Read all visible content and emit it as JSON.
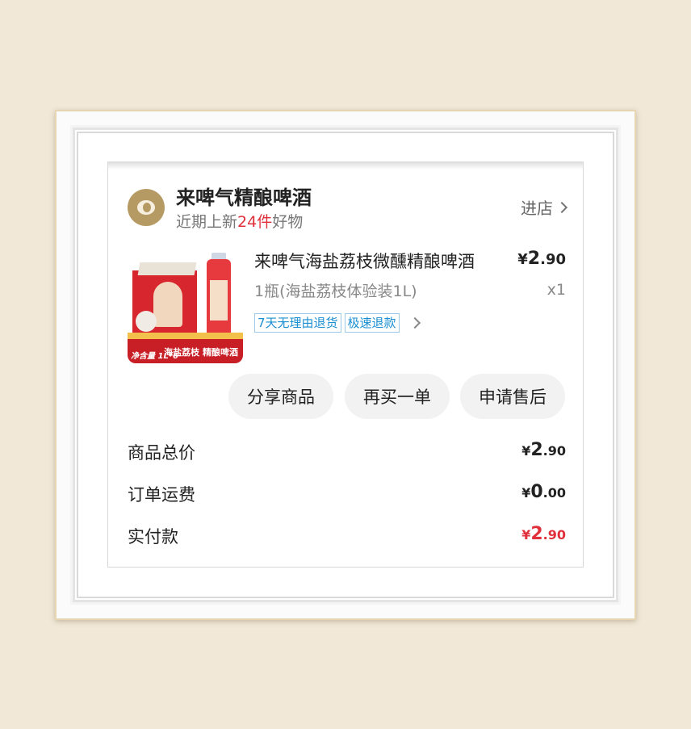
{
  "store": {
    "name": "来啤气精酿啤酒",
    "sub_prefix": "近期上新",
    "sub_count": "24件",
    "sub_suffix": "好物",
    "enter_label": "进店"
  },
  "product": {
    "title": "来啤气海盐荔枝微醺精酿啤酒",
    "price_yen": "¥",
    "price_int": "2",
    "price_dec": ".90",
    "spec": "1瓶(海盐荔枝体验装1L)",
    "qty": "x1",
    "tags": [
      "7天无理由退货",
      "极速退款"
    ],
    "image_band_left": "净含量 1L*6",
    "image_band_right": "海盐荔枝 精酿啤酒"
  },
  "actions": {
    "share": "分享商品",
    "rebuy": "再买一单",
    "after_sale": "申请售后"
  },
  "summary": [
    {
      "label": "商品总价",
      "yen": "¥",
      "int": "2",
      "dec": ".90"
    },
    {
      "label": "订单运费",
      "yen": "¥",
      "int": "0",
      "dec": ".00"
    },
    {
      "label": "实付款",
      "yen": "¥",
      "int": "2",
      "dec": ".90"
    }
  ],
  "colors": {
    "accent_red": "#e0303b",
    "tag_blue": "#1a8fd1",
    "logo_gold": "#b69a64"
  }
}
